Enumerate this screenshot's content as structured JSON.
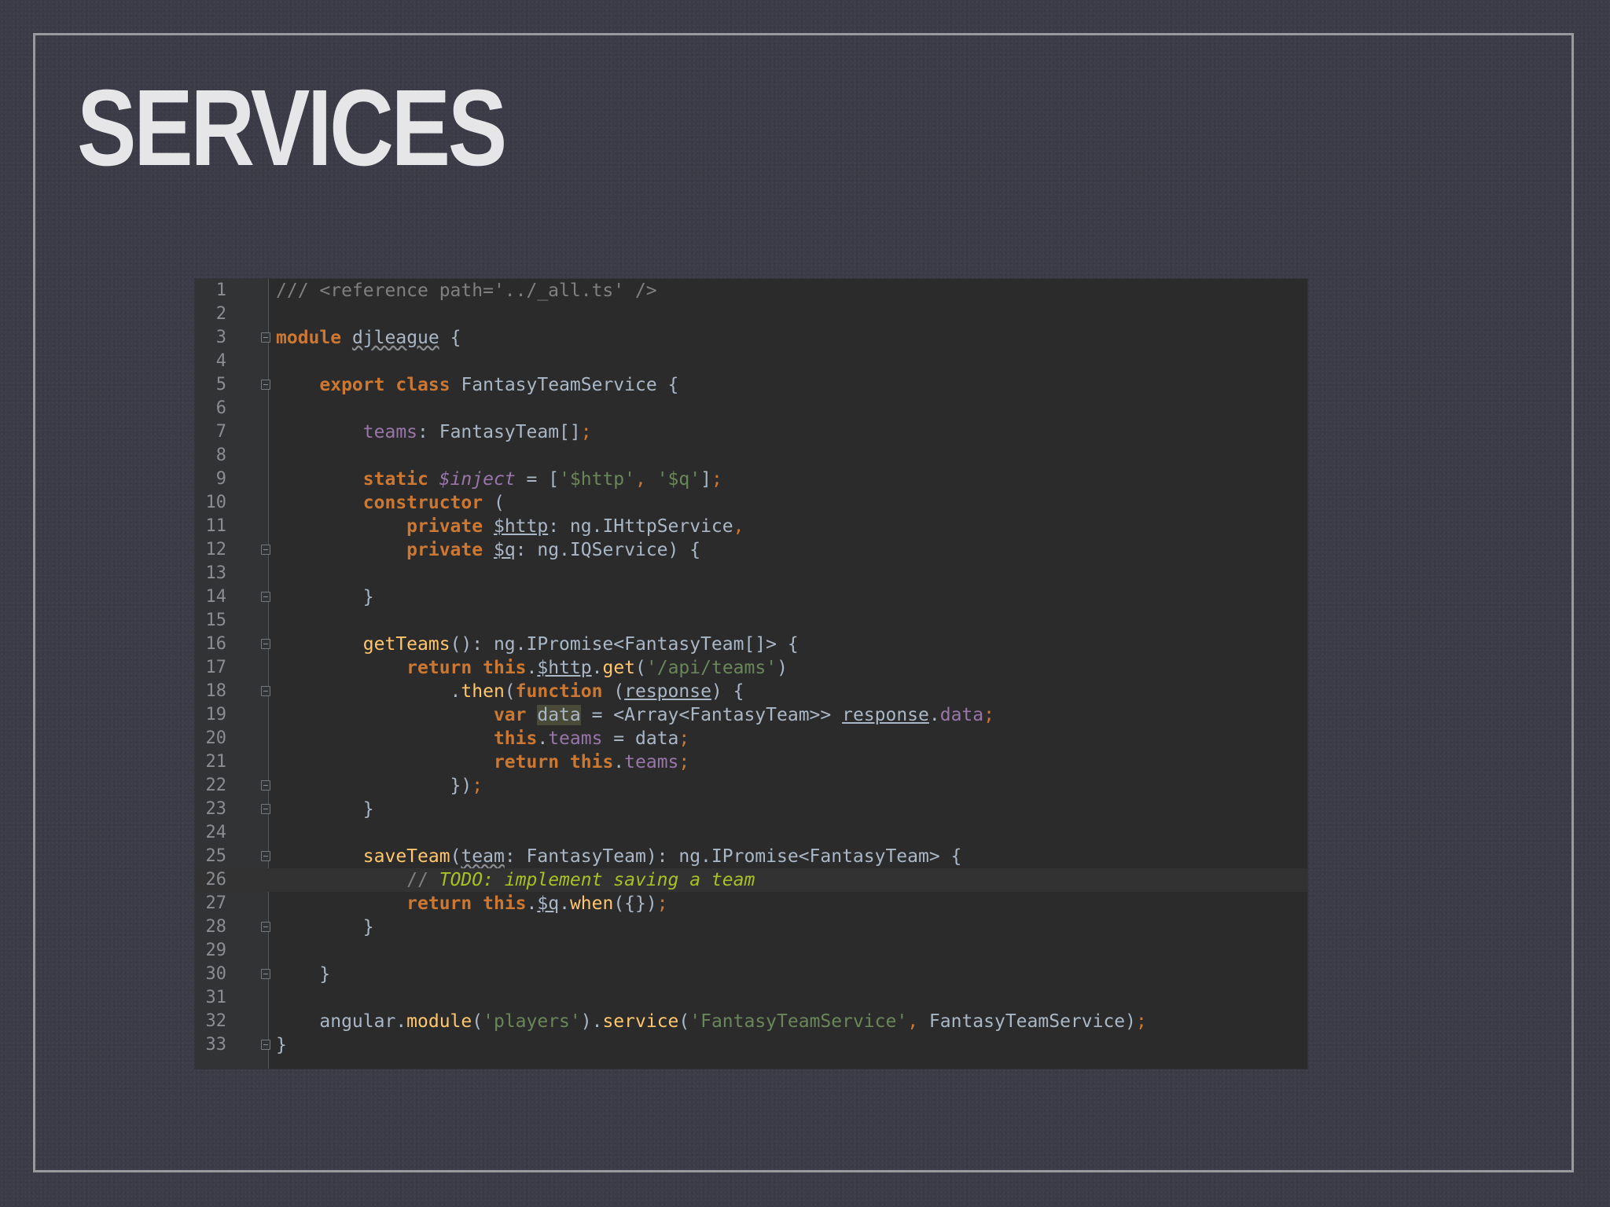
{
  "slide": {
    "title": "SERVICES"
  },
  "editor": {
    "current_line": 26,
    "fold_marker_lines": [
      3,
      5,
      12,
      14,
      16,
      18,
      22,
      23,
      25,
      28,
      30,
      33
    ],
    "lines": [
      {
        "number": "1",
        "tokens": [
          {
            "t": "/// <reference path='../_all.ts' />",
            "c": "comment"
          }
        ]
      },
      {
        "number": "2",
        "tokens": []
      },
      {
        "number": "3",
        "tokens": [
          {
            "t": "module",
            "c": "keyword"
          },
          {
            "t": " "
          },
          {
            "t": "djleague",
            "c": "plain wavy"
          },
          {
            "t": " {"
          }
        ]
      },
      {
        "number": "4",
        "tokens": []
      },
      {
        "number": "5",
        "tokens": [
          {
            "t": "    "
          },
          {
            "t": "export",
            "c": "keyword"
          },
          {
            "t": " "
          },
          {
            "t": "class",
            "c": "keyword"
          },
          {
            "t": " FantasyTeamService {"
          }
        ]
      },
      {
        "number": "6",
        "tokens": []
      },
      {
        "number": "7",
        "tokens": [
          {
            "t": "        "
          },
          {
            "t": "teams",
            "c": "field"
          },
          {
            "t": ": FantasyTeam[]"
          },
          {
            "t": ";",
            "c": "punct"
          }
        ]
      },
      {
        "number": "8",
        "tokens": []
      },
      {
        "number": "9",
        "tokens": [
          {
            "t": "        "
          },
          {
            "t": "static",
            "c": "keyword"
          },
          {
            "t": " "
          },
          {
            "t": "$inject",
            "c": "static"
          },
          {
            "t": " = ["
          },
          {
            "t": "'$http'",
            "c": "string"
          },
          {
            "t": ", ",
            "c": "punct"
          },
          {
            "t": "'$q'",
            "c": "string"
          },
          {
            "t": "]"
          },
          {
            "t": ";",
            "c": "punct"
          }
        ]
      },
      {
        "number": "10",
        "tokens": [
          {
            "t": "        "
          },
          {
            "t": "constructor",
            "c": "keyword"
          },
          {
            "t": " ("
          }
        ]
      },
      {
        "number": "11",
        "tokens": [
          {
            "t": "            "
          },
          {
            "t": "private",
            "c": "keyword"
          },
          {
            "t": " "
          },
          {
            "t": "$http",
            "c": "plain under"
          },
          {
            "t": ": ng.IHttpService"
          },
          {
            "t": ",",
            "c": "punct"
          }
        ]
      },
      {
        "number": "12",
        "tokens": [
          {
            "t": "            "
          },
          {
            "t": "private",
            "c": "keyword"
          },
          {
            "t": " "
          },
          {
            "t": "$q",
            "c": "plain under"
          },
          {
            "t": ": ng.IQService) {"
          }
        ]
      },
      {
        "number": "13",
        "tokens": []
      },
      {
        "number": "14",
        "tokens": [
          {
            "t": "        }"
          }
        ]
      },
      {
        "number": "15",
        "tokens": []
      },
      {
        "number": "16",
        "tokens": [
          {
            "t": "        "
          },
          {
            "t": "getTeams",
            "c": "method"
          },
          {
            "t": "(): ng.IPromise<FantasyTeam[]> {"
          }
        ]
      },
      {
        "number": "17",
        "tokens": [
          {
            "t": "            "
          },
          {
            "t": "return",
            "c": "keyword"
          },
          {
            "t": " "
          },
          {
            "t": "this",
            "c": "keyword"
          },
          {
            "t": "."
          },
          {
            "t": "$http",
            "c": "plain under"
          },
          {
            "t": "."
          },
          {
            "t": "get",
            "c": "method"
          },
          {
            "t": "("
          },
          {
            "t": "'/api/teams'",
            "c": "string"
          },
          {
            "t": ")"
          }
        ]
      },
      {
        "number": "18",
        "tokens": [
          {
            "t": "                ."
          },
          {
            "t": "then",
            "c": "method"
          },
          {
            "t": "("
          },
          {
            "t": "function",
            "c": "keyword"
          },
          {
            "t": " ("
          },
          {
            "t": "response",
            "c": "plain under"
          },
          {
            "t": ") {"
          }
        ]
      },
      {
        "number": "19",
        "tokens": [
          {
            "t": "                    "
          },
          {
            "t": "var",
            "c": "keyword"
          },
          {
            "t": " "
          },
          {
            "t": "data",
            "c": "plain hl"
          },
          {
            "t": " = <Array<FantasyTeam>> "
          },
          {
            "t": "response",
            "c": "plain under"
          },
          {
            "t": "."
          },
          {
            "t": "data",
            "c": "field"
          },
          {
            "t": ";",
            "c": "punct"
          }
        ]
      },
      {
        "number": "20",
        "tokens": [
          {
            "t": "                    "
          },
          {
            "t": "this",
            "c": "keyword"
          },
          {
            "t": "."
          },
          {
            "t": "teams",
            "c": "field"
          },
          {
            "t": " = data"
          },
          {
            "t": ";",
            "c": "punct"
          }
        ]
      },
      {
        "number": "21",
        "tokens": [
          {
            "t": "                    "
          },
          {
            "t": "return",
            "c": "keyword"
          },
          {
            "t": " "
          },
          {
            "t": "this",
            "c": "keyword"
          },
          {
            "t": "."
          },
          {
            "t": "teams",
            "c": "field"
          },
          {
            "t": ";",
            "c": "punct"
          }
        ]
      },
      {
        "number": "22",
        "tokens": [
          {
            "t": "                })"
          },
          {
            "t": ";",
            "c": "punct"
          }
        ]
      },
      {
        "number": "23",
        "tokens": [
          {
            "t": "        }"
          }
        ]
      },
      {
        "number": "24",
        "tokens": []
      },
      {
        "number": "25",
        "tokens": [
          {
            "t": "        "
          },
          {
            "t": "saveTeam",
            "c": "method"
          },
          {
            "t": "("
          },
          {
            "t": "team",
            "c": "plain wavy"
          },
          {
            "t": ": FantasyTeam): ng.IPromise<FantasyTeam> {"
          }
        ]
      },
      {
        "number": "26",
        "tokens": [
          {
            "t": "            "
          },
          {
            "t": "// ",
            "c": "comment"
          },
          {
            "t": "TODO: implement saving a team",
            "c": "todo"
          }
        ]
      },
      {
        "number": "27",
        "tokens": [
          {
            "t": "            "
          },
          {
            "t": "return",
            "c": "keyword"
          },
          {
            "t": " "
          },
          {
            "t": "this",
            "c": "keyword"
          },
          {
            "t": "."
          },
          {
            "t": "$q",
            "c": "plain under"
          },
          {
            "t": "."
          },
          {
            "t": "when",
            "c": "method"
          },
          {
            "t": "({})"
          },
          {
            "t": ";",
            "c": "punct"
          }
        ]
      },
      {
        "number": "28",
        "tokens": [
          {
            "t": "        }"
          }
        ]
      },
      {
        "number": "29",
        "tokens": []
      },
      {
        "number": "30",
        "tokens": [
          {
            "t": "    }"
          }
        ]
      },
      {
        "number": "31",
        "tokens": []
      },
      {
        "number": "32",
        "tokens": [
          {
            "t": "    angular."
          },
          {
            "t": "module",
            "c": "method"
          },
          {
            "t": "("
          },
          {
            "t": "'players'",
            "c": "string"
          },
          {
            "t": ")."
          },
          {
            "t": "service",
            "c": "method"
          },
          {
            "t": "("
          },
          {
            "t": "'FantasyTeamService'",
            "c": "string"
          },
          {
            "t": ", ",
            "c": "punct"
          },
          {
            "t": "FantasyTeamService)"
          },
          {
            "t": ";",
            "c": "punct"
          }
        ]
      },
      {
        "number": "33",
        "tokens": [
          {
            "t": "}"
          }
        ]
      }
    ]
  },
  "colors": {
    "background": "#3c3c48",
    "editor_background": "#2b2b2b",
    "keyword": "#cc7832",
    "string": "#6a8759",
    "field": "#9876aa",
    "method": "#ffc66d",
    "comment": "#808080",
    "todo": "#a8c023"
  }
}
